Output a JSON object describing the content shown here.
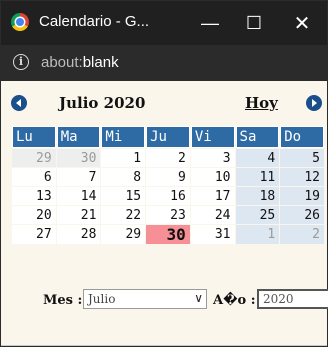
{
  "window": {
    "title": "Calendario - G..."
  },
  "titlebar_controls": {
    "minimize": "—",
    "maximize": "☐",
    "close": "✕"
  },
  "address": {
    "scheme": "about:",
    "host": "blank",
    "info_glyph": "i"
  },
  "calendar": {
    "month_title": "Julio 2020",
    "today_link": "Hoy",
    "weekdays": [
      "Lu",
      "Ma",
      "Mi",
      "Ju",
      "Vi",
      "Sa",
      "Do"
    ],
    "weeks": [
      [
        "29",
        "30",
        "1",
        "2",
        "3",
        "4",
        "5"
      ],
      [
        "6",
        "7",
        "8",
        "9",
        "10",
        "11",
        "12"
      ],
      [
        "13",
        "14",
        "15",
        "16",
        "17",
        "18",
        "19"
      ],
      [
        "20",
        "21",
        "22",
        "23",
        "24",
        "25",
        "26"
      ],
      [
        "27",
        "28",
        "29",
        "30",
        "31",
        "1",
        "2"
      ]
    ],
    "today": "30",
    "controls": {
      "month_label": "Mes :",
      "month_value": "Julio",
      "year_label": "A�o :",
      "year_value": "2020"
    },
    "colors": {
      "header": "#2e6aa3",
      "weekend": "#dde7f2",
      "today": "#f78f97",
      "nav": "#1a4f8c"
    }
  }
}
